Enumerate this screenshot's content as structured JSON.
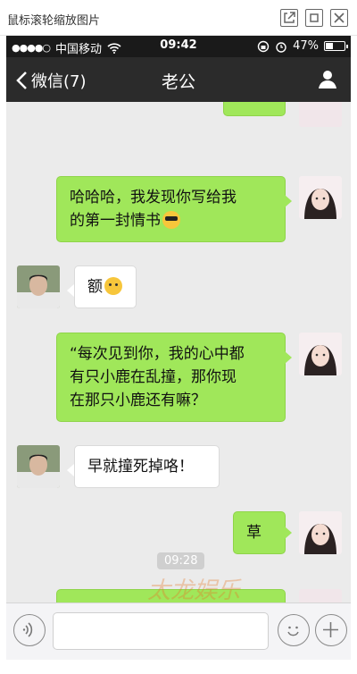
{
  "viewer": {
    "title": "鼠标滚轮缩放图片"
  },
  "status_bar": {
    "carrier": "中国移动",
    "time": "09:42",
    "battery": "47%",
    "battery_level": 0.47
  },
  "nav": {
    "back_label": "微信(7)",
    "title": "老公"
  },
  "messages": [
    {
      "side": "right",
      "text_lines": [
        "哈哈哈，我发现你写给我",
        "的第一封情书"
      ],
      "emoji": "cool-face"
    },
    {
      "side": "left",
      "text_lines": [
        "额"
      ],
      "emoji": "thinking-face"
    },
    {
      "side": "right",
      "text_lines": [
        "“每次见到你，我的心中都",
        "有只小鹿在乱撞，那你现",
        "在那只小鹿还有嘛？"
      ]
    },
    {
      "side": "left",
      "text_lines": [
        "早就撞死掉咯！"
      ]
    },
    {
      "side": "right",
      "text_lines": [
        "草"
      ]
    }
  ],
  "timestamp": "09:28",
  "watermark": "太龙娱乐",
  "colors": {
    "green_bubble": "#a0e75a",
    "nav_bg": "#2b2b2b",
    "chat_bg": "#ebebeb"
  }
}
